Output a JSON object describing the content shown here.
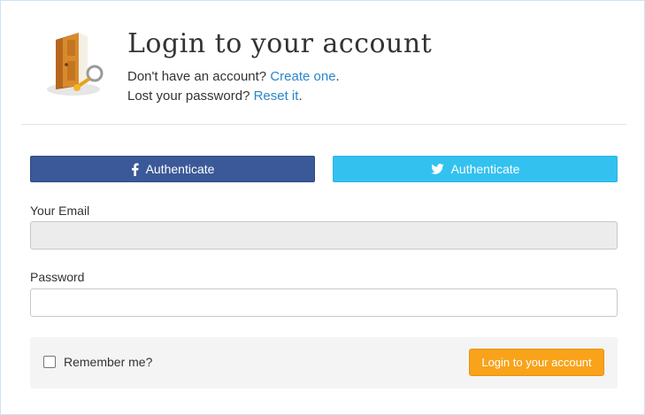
{
  "header": {
    "title": "Login to your account",
    "signup_prompt": "Don't have an account?",
    "signup_link": "Create one",
    "signup_suffix": ".",
    "reset_prompt": "Lost your password?",
    "reset_link": "Reset it",
    "reset_suffix": ".",
    "logo_icon": "door-key-icon"
  },
  "social": {
    "facebook": {
      "label": "Authenticate",
      "icon": "facebook-icon",
      "color": "#3b5998"
    },
    "twitter": {
      "label": "Authenticate",
      "icon": "twitter-icon",
      "color": "#33c1f0"
    }
  },
  "form": {
    "email_label": "Your Email",
    "email_value": "",
    "password_label": "Password",
    "password_value": "",
    "remember_label": "Remember me?",
    "remember_checked": false,
    "submit_label": "Login to your account"
  },
  "colors": {
    "link": "#2a86c8",
    "submit": "#f8a31a"
  }
}
